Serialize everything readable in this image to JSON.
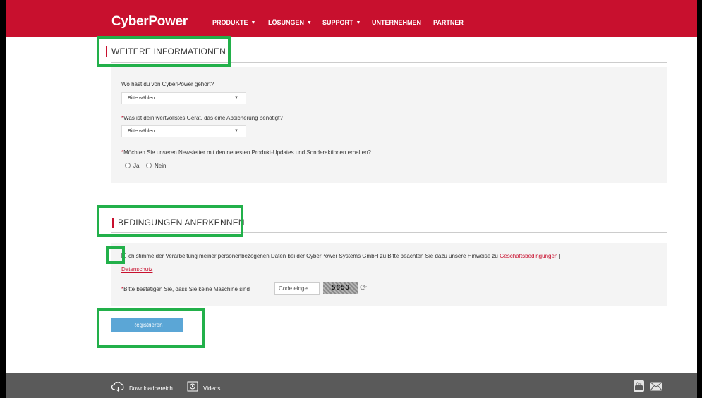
{
  "header": {
    "logo": "CyberPower",
    "nav": [
      {
        "label": "PRODUKTE",
        "has_dropdown": true
      },
      {
        "label": "LÖSUNGEN",
        "has_dropdown": true
      },
      {
        "label": "SUPPORT",
        "has_dropdown": true
      },
      {
        "label": "UNTERNEHMEN",
        "has_dropdown": false
      },
      {
        "label": "PARTNER",
        "has_dropdown": false
      }
    ]
  },
  "section_info": {
    "title": "WEITERE INFORMATIONEN",
    "q1": {
      "label": "Wo hast du von CyberPower gehört?",
      "value": "Bitte wählen"
    },
    "q2": {
      "required_mark": "*",
      "label": "Was ist dein wertvollstes Gerät, das eine Absicherung benötigt?",
      "value": "Bitte wählen"
    },
    "q3": {
      "required_mark": "*",
      "label": "Möchten Sie unseren Newsletter mit den neuesten Produkt-Updates und Sonderaktionen erhalten?"
    },
    "radio_yes": "Ja",
    "radio_no": "Nein"
  },
  "section_terms": {
    "title": "BEDINGUNGEN ANERKENNEN",
    "consent_text": "ch stimme der Verarbeitung meiner personenbezogenen Daten bei der CyberPower Systems GmbH zu Bitte beachten Sie dazu unsere Hinweise zu",
    "link_terms": "Geschäftsbedingungen",
    "separator": "|",
    "link_privacy": "Datenschutz",
    "captcha_required_mark": "*",
    "captcha_label": "Bitte bestätigen Sie, dass Sie keine Maschine sind",
    "captcha_placeholder": "Code einge",
    "captcha_code": "5653"
  },
  "register_button": "Registrieren",
  "footer": {
    "download_label": "Downloadbereich",
    "videos_label": "Videos"
  },
  "colors": {
    "brand_red": "#c8102e",
    "highlight_green": "#22b04a",
    "button_blue": "#5ba6d6",
    "footer_gray": "#5a5a5a"
  }
}
